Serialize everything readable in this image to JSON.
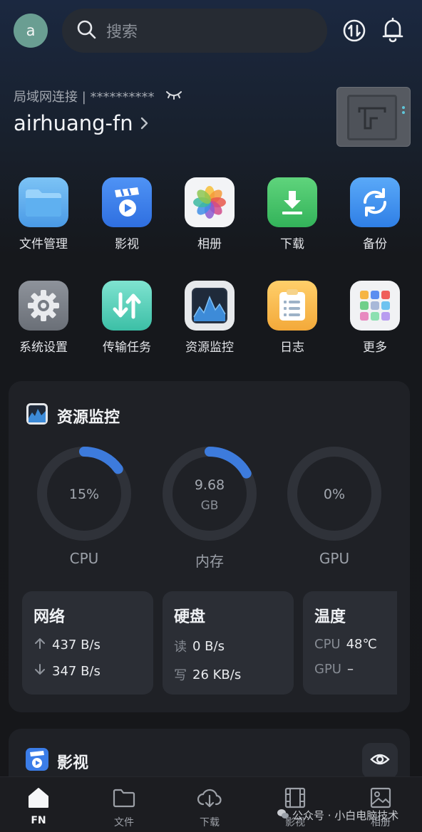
{
  "header": {
    "avatar_letter": "a",
    "search_placeholder": "搜索"
  },
  "device": {
    "connection_label": "局域网连接 | **********",
    "name": "airhuang-fn"
  },
  "apps": [
    {
      "label": "文件管理",
      "icon": "folder-icon"
    },
    {
      "label": "影视",
      "icon": "video-app-icon"
    },
    {
      "label": "相册",
      "icon": "photos-icon"
    },
    {
      "label": "下载",
      "icon": "download-app-icon"
    },
    {
      "label": "备份",
      "icon": "backup-icon"
    },
    {
      "label": "系统设置",
      "icon": "settings-icon"
    },
    {
      "label": "传输任务",
      "icon": "transfer-icon"
    },
    {
      "label": "资源监控",
      "icon": "monitor-icon"
    },
    {
      "label": "日志",
      "icon": "log-icon"
    },
    {
      "label": "更多",
      "icon": "more-apps-icon"
    }
  ],
  "resource": {
    "title": "资源监控",
    "cpu": {
      "value": "15%",
      "label": "CPU",
      "fraction": 0.15
    },
    "memory": {
      "value": "9.68",
      "unit": "GB",
      "label": "内存",
      "fraction": 0.17
    },
    "gpu": {
      "value": "0%",
      "label": "GPU",
      "fraction": 0.0
    },
    "network": {
      "title": "网络",
      "up": "437 B/s",
      "down": "347 B/s"
    },
    "disk": {
      "title": "硬盘",
      "read_label": "读",
      "read": "0 B/s",
      "write_label": "写",
      "write": "26 KB/s"
    },
    "temperature": {
      "title": "温度",
      "cpu_label": "CPU",
      "cpu": "48℃",
      "gpu_label": "GPU",
      "gpu": "–"
    }
  },
  "video_section": {
    "title": "影视"
  },
  "tabs": [
    {
      "label": "FN",
      "active": true
    },
    {
      "label": "文件"
    },
    {
      "label": "下载"
    },
    {
      "label": "影视"
    },
    {
      "label": "相册"
    }
  ],
  "watermark": "公众号 · 小白电脑技术",
  "colors": {
    "accent": "#3d7bdc",
    "ring_track": "#2f3239",
    "card": "#1f2126"
  }
}
